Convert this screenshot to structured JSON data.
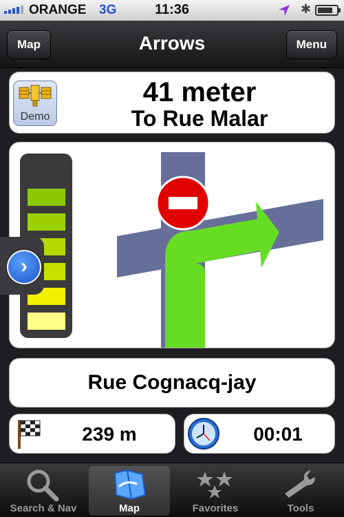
{
  "status_bar": {
    "carrier": "ORANGE",
    "network": "3G",
    "time": "11:36"
  },
  "nav": {
    "left_button": "Map",
    "title": "Arrows",
    "right_button": "Menu"
  },
  "instruction": {
    "demo_label": "Demo",
    "distance": "41 meter",
    "to_street": "To  Rue Malar"
  },
  "signal_meter": {
    "bar_colors": [
      "#ffff88",
      "#f0f000",
      "#c8e000",
      "#b4d800",
      "#9cd000",
      "#8cc800"
    ]
  },
  "current_street": "Rue Cognacq-jay",
  "remaining": {
    "distance": "239 m",
    "time": "00:01"
  },
  "tabs": [
    {
      "label": "Search & Nav",
      "icon": "magnifier-icon",
      "selected": false
    },
    {
      "label": "Map",
      "icon": "map-icon",
      "selected": true
    },
    {
      "label": "Favorites",
      "icon": "stars-icon",
      "selected": false
    },
    {
      "label": "Tools",
      "icon": "wrench-icon",
      "selected": false
    }
  ],
  "colors": {
    "turn_arrow": "#66dd22",
    "road": "#666e99",
    "no_entry": "#e00000"
  }
}
